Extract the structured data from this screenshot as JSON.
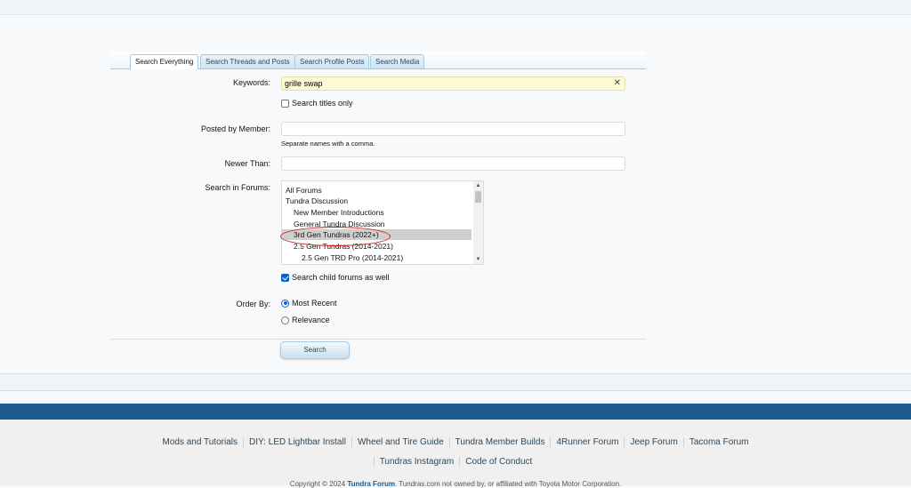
{
  "tabs": [
    "Search Everything",
    "Search Threads and Posts",
    "Search Profile Posts",
    "Search Media"
  ],
  "form": {
    "keywords_label": "Keywords:",
    "keywords_value": "grille swap",
    "search_titles_label": "Search titles only",
    "posted_by_label": "Posted by Member:",
    "posted_by_value": "",
    "posted_by_hint": "Separate names with a comma.",
    "newer_than_label": "Newer Than:",
    "newer_than_value": "",
    "search_in_forums_label": "Search in Forums:",
    "forum_options": [
      {
        "label": "All Forums",
        "indent": 0,
        "selected": false
      },
      {
        "label": "Tundra Discussion",
        "indent": 0,
        "selected": false
      },
      {
        "label": "New Member Introductions",
        "indent": 1,
        "selected": false
      },
      {
        "label": "General Tundra Discussion",
        "indent": 1,
        "selected": false
      },
      {
        "label": "3rd Gen Tundras (2022+)",
        "indent": 1,
        "selected": true
      },
      {
        "label": "2.5 Gen Tundras (2014-2021)",
        "indent": 1,
        "selected": false
      },
      {
        "label": "2.5 Gen TRD Pro (2014-2021)",
        "indent": 2,
        "selected": false
      }
    ],
    "child_forums_label": "Search child forums as well",
    "order_by_label": "Order By:",
    "order_most_recent": "Most Recent",
    "order_relevance": "Relevance",
    "search_button": "Search"
  },
  "footer": {
    "links_row1": [
      "Mods and Tutorials",
      "DIY: LED Lightbar Install",
      "Wheel and Tire Guide",
      "Tundra Member Builds",
      "4Runner Forum",
      "Jeep Forum",
      "Tacoma Forum"
    ],
    "links_row2": [
      "Tundras Instagram",
      "Code of Conduct"
    ],
    "copyright_prefix": "Copyright © 2024",
    "copyright_site": "Tundra Forum",
    "copyright_suffix": ". Tundras.com not owned by, or affiliated with Toyota Motor Corporation."
  },
  "colors": {
    "accent": "#1e5b91",
    "keyword_bg": "#fdfbd6",
    "highlight": "#d11a1a"
  }
}
